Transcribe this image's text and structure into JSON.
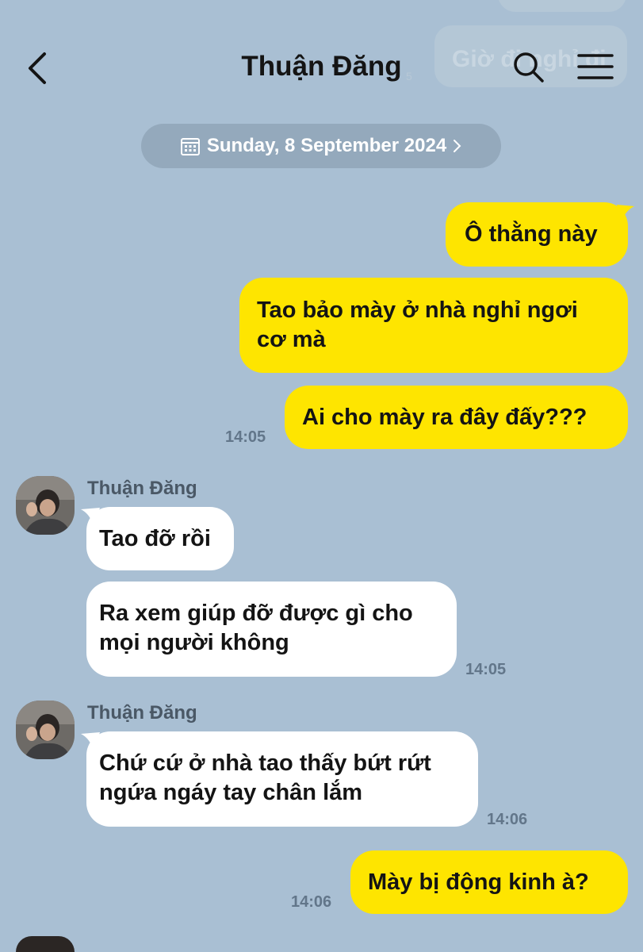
{
  "header": {
    "title": "Thuận Đăng",
    "back_icon": "chevron-left-icon",
    "search_icon": "search-icon",
    "menu_icon": "menu-icon"
  },
  "ghost": {
    "top_text": "Giờ đi nghỉ đi",
    "time": "5"
  },
  "date_divider": {
    "icon": "calendar-icon",
    "label": "Sunday, 8 September 2024"
  },
  "messages": [
    {
      "side": "out",
      "text": "Ô thằng này"
    },
    {
      "side": "out",
      "line1": "Tao bảo mày ở nhà nghỉ ngơi",
      "line2": "cơ mà"
    },
    {
      "side": "out",
      "text": "Ai cho mày ra đây đấy???",
      "time": "14:05"
    },
    {
      "side": "in",
      "sender": "Thuận Đăng",
      "text": "Tao đỡ rồi"
    },
    {
      "side": "in",
      "line1": "Ra xem giúp đỡ được gì cho",
      "line2": "mọi người không",
      "time": "14:05"
    },
    {
      "side": "in",
      "sender": "Thuận Đăng",
      "line1": "Chứ cứ ở nhà tao thấy bứt rứt",
      "line2": "ngứa ngáy tay chân lắm",
      "time": "14:06"
    },
    {
      "side": "out",
      "text": "Mày bị động kinh à?",
      "time": "14:06"
    }
  ],
  "colors": {
    "background": "#a9bfd3",
    "outgoing_bubble": "#fee500",
    "incoming_bubble": "#ffffff",
    "date_pill": "#94a9bc"
  }
}
